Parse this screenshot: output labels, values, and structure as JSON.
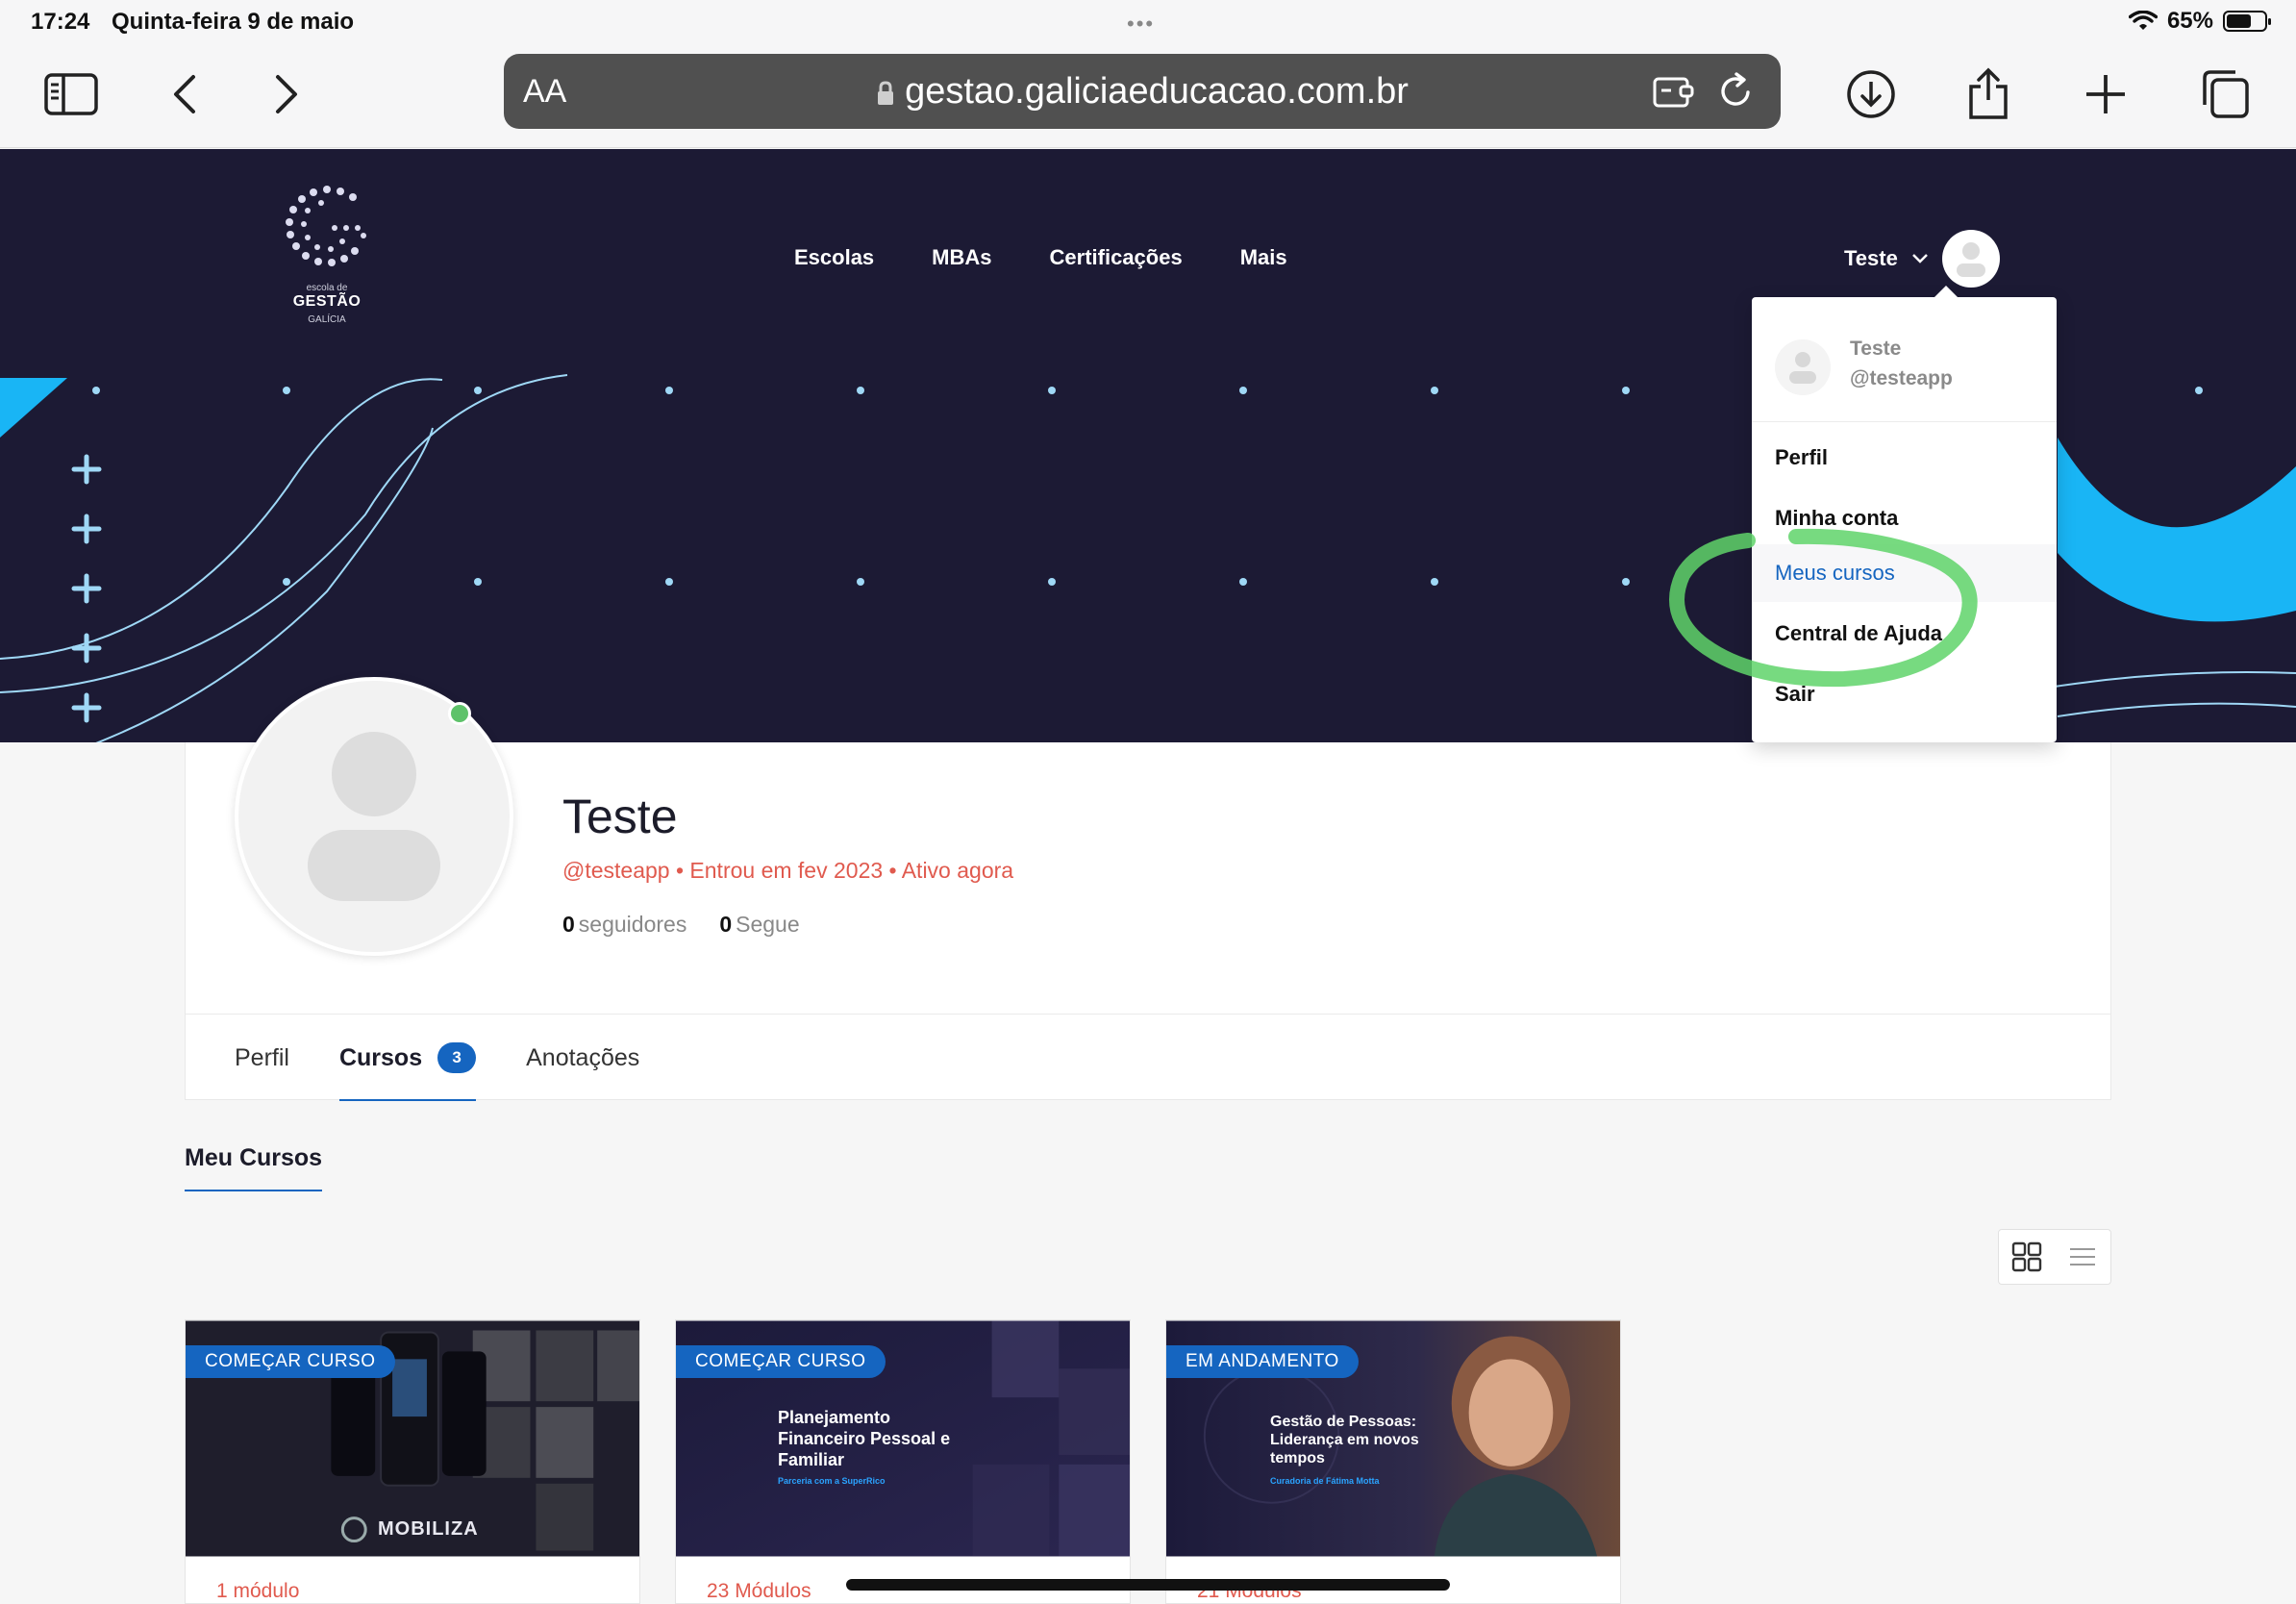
{
  "status_bar": {
    "time": "17:24",
    "date": "Quinta-feira 9 de maio",
    "battery": "65%",
    "battery_level": 0.65,
    "dots": "•••"
  },
  "browser": {
    "aa": "AA",
    "url": "gestao.galiciaeducacao.com.br"
  },
  "site": {
    "logo": {
      "sub": "escola de",
      "main": "GESTÃO",
      "brand": "GALÍCIA"
    },
    "nav": [
      "Escolas",
      "MBAs",
      "Certificações",
      "Mais"
    ],
    "user_name": "Teste"
  },
  "dropdown": {
    "name": "Teste",
    "handle": "@testeapp",
    "items": [
      "Perfil",
      "Minha conta",
      "Meus cursos",
      "Central de Ajuda",
      "Sair"
    ],
    "active_index": 2
  },
  "profile": {
    "name": "Teste",
    "meta": "@testeapp • Entrou em fev 2023 • Ativo agora",
    "followers_count": "0",
    "followers_label": "seguidores",
    "following_count": "0",
    "following_label": "Segue"
  },
  "tabs": [
    {
      "label": "Perfil"
    },
    {
      "label": "Cursos",
      "badge": "3"
    },
    {
      "label": "Anotações"
    }
  ],
  "section_title": "Meu Cursos",
  "courses": [
    {
      "badge": "COMEÇAR CURSO",
      "title": "",
      "tagline": "",
      "brand": "MOBILIZA",
      "modules": "1 módulo"
    },
    {
      "badge": "COMEÇAR CURSO",
      "title": "Planejamento Financeiro Pessoal e Familiar",
      "tagline": "Parceria com a SuperRico",
      "modules": "23 Módulos"
    },
    {
      "badge": "EM ANDAMENTO",
      "title": "Gestão de Pessoas: Liderança em novos tempos",
      "tagline": "Curadoria de Fátima Motta",
      "modules": "21 Módulos"
    }
  ],
  "colors": {
    "banner": "#1c1a34",
    "accent": "#1565c0",
    "meta": "#e05a4e",
    "highlight": "#5fd36a",
    "cyan": "#19b5f5"
  }
}
